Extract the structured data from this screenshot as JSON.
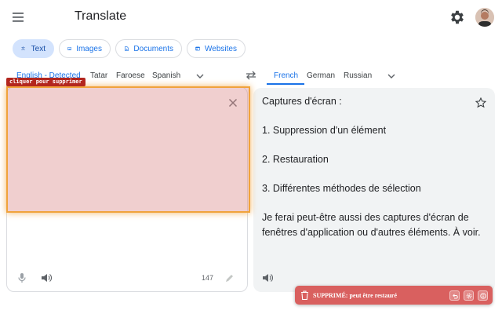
{
  "header": {
    "title": "Translate"
  },
  "modes": [
    {
      "label": "Text",
      "icon": "translate-icon",
      "active": true
    },
    {
      "label": "Images",
      "icon": "image-icon",
      "active": false
    },
    {
      "label": "Documents",
      "icon": "document-icon",
      "active": false
    },
    {
      "label": "Websites",
      "icon": "website-icon",
      "active": false
    }
  ],
  "source_languages": [
    "English - Detected",
    "Tatar",
    "Faroese",
    "Spanish"
  ],
  "target_languages": [
    "French",
    "German",
    "Russian"
  ],
  "source": {
    "char_count": "147"
  },
  "translation": {
    "lines": [
      "Captures d'écran :",
      "1. Suppression d'un élément",
      "2. Restauration",
      "3. Différentes méthodes de sélection",
      "Je ferai peut-être aussi des captures d'écran de fenêtres d'application ou d'autres éléments. À voir."
    ]
  },
  "overlay": {
    "tag": "cliquer pour supprimer"
  },
  "toast": {
    "text": "SUPPRIMÉ: peut être restauré"
  },
  "colors": {
    "accent": "#1a73e8",
    "overlay_border": "#f0a33c",
    "toast_bg": "#d9605f"
  }
}
